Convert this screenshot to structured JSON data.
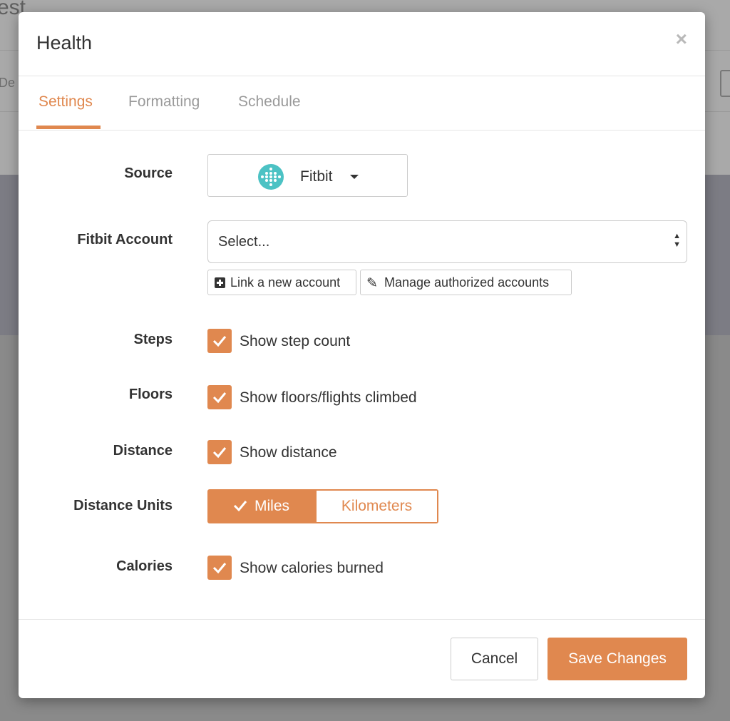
{
  "background": {
    "title_fragment": "est",
    "subtitle_fragment": "De"
  },
  "modal": {
    "title": "Health",
    "close_symbol": "×"
  },
  "tabs": [
    {
      "label": "Settings",
      "active": true
    },
    {
      "label": "Formatting",
      "active": false
    },
    {
      "label": "Schedule",
      "active": false
    }
  ],
  "fields": {
    "source": {
      "label": "Source",
      "value": "Fitbit",
      "icon": "fitbit-logo-icon"
    },
    "account": {
      "label": "Fitbit Account",
      "select_value": "Select...",
      "link_button": "Link a new account",
      "manage_button": "Manage authorized accounts"
    },
    "steps": {
      "label": "Steps",
      "checkbox_label": "Show step count",
      "checked": true
    },
    "floors": {
      "label": "Floors",
      "checkbox_label": "Show floors/flights climbed",
      "checked": true
    },
    "distance": {
      "label": "Distance",
      "checkbox_label": "Show distance",
      "checked": true
    },
    "distance_units": {
      "label": "Distance Units",
      "options": [
        "Miles",
        "Kilometers"
      ],
      "selected": "Miles"
    },
    "calories": {
      "label": "Calories",
      "checkbox_label": "Show calories burned",
      "checked": true
    }
  },
  "footer": {
    "cancel_label": "Cancel",
    "save_label": "Save Changes"
  },
  "colors": {
    "accent": "#e0884f",
    "fitbit": "#4cc2c4"
  }
}
